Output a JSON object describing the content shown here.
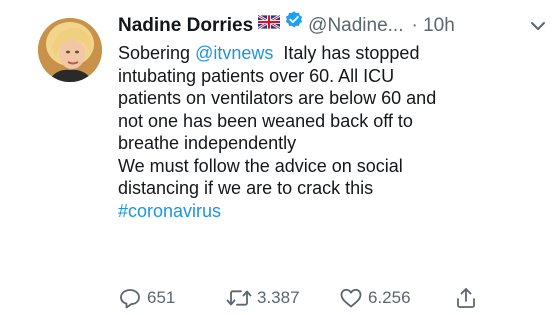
{
  "tweet": {
    "author_name": "Nadine Dorries",
    "handle": "@Nadine...",
    "time": "· 10h",
    "text_lines": [
      {
        "before": "Sobering ",
        "link": "@itvnews",
        "after": "  Italy has stopped"
      },
      {
        "text": "intubating patients over 60. All ICU"
      },
      {
        "text": "patients on ventilators are below 60 and"
      },
      {
        "text": "not one has been weaned back off to"
      },
      {
        "text": "breathe independently"
      },
      {
        "text": "We must follow the advice on social"
      },
      {
        "text": "distancing if we are to crack this"
      },
      {
        "link": "#coronavirus"
      }
    ],
    "replies": "651",
    "retweets": "3.387",
    "likes": "6.256"
  },
  "icons": {
    "flag": "uk-flag-icon",
    "verified": "verified-badge-icon",
    "more": "chevron-down-icon",
    "reply": "reply-icon",
    "retweet": "retweet-icon",
    "like": "heart-icon",
    "share": "share-icon"
  },
  "colors": {
    "link": "#1b95e0",
    "verified": "#1da1f2",
    "muted": "#5b6670",
    "text": "#14171a"
  }
}
